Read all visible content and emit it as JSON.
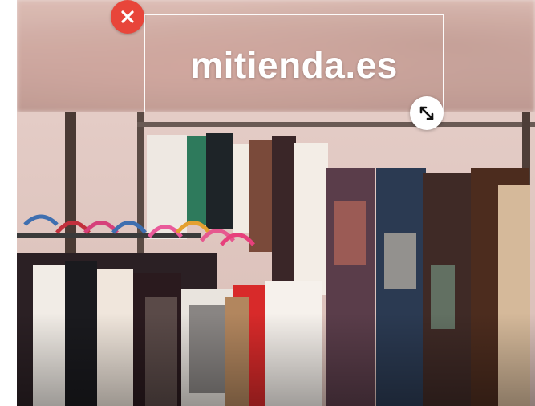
{
  "text_box": {
    "label": "mitienda.es"
  },
  "handles": {
    "close_icon": "close-icon",
    "resize_icon": "resize-diagonal-icon"
  },
  "colors": {
    "close_bg": "#e8453a",
    "resize_bg": "#ffffff",
    "text": "#ffffff"
  }
}
